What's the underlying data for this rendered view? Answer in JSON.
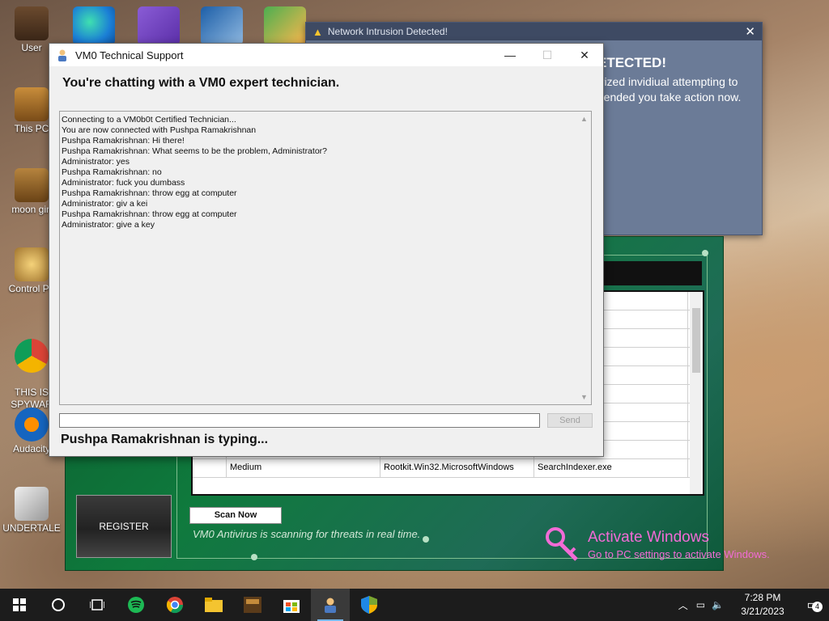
{
  "desktop": {
    "icons": [
      {
        "label": "User"
      },
      {
        "label": "This PC"
      },
      {
        "label": "moon girl"
      },
      {
        "label": "Control Pa"
      },
      {
        "label": "THIS IS\nSPYWAR"
      },
      {
        "label": "Audacity"
      },
      {
        "label": "UNDERTALE"
      }
    ]
  },
  "intrusion_popup": {
    "title": "Network Intrusion Detected!",
    "headline": "ETECTED!",
    "message": "orized invidiual attempting to mended you take action now."
  },
  "antivirus": {
    "rows": [
      {
        "c0": "",
        "c1": "",
        "c2": "",
        "c3": ""
      },
      {
        "c0": "",
        "c1": "",
        "c2": "",
        "c3": ""
      },
      {
        "c0": "",
        "c1": "",
        "c2": "",
        "c3": ""
      },
      {
        "c0": "",
        "c1": "",
        "c2": "",
        "c3": "e"
      },
      {
        "c0": "",
        "c1": "",
        "c2": "",
        "c3": ""
      },
      {
        "c0": "",
        "c1": "",
        "c2": "",
        "c3": ""
      },
      {
        "c0": "",
        "c1": "",
        "c2": "",
        "c3": ""
      },
      {
        "c0": "",
        "c1": "",
        "c2": "",
        "c3": ""
      },
      {
        "c0": "",
        "c1": "High",
        "c2": "Downloader.Win32.PornoDownloader",
        "c3": "svchost.exe"
      },
      {
        "c0": "",
        "c1": "Medium",
        "c2": "Rootkit.Win32.MicrosoftWindows",
        "c3": "SearchIndexer.exe"
      }
    ],
    "register_label": "REGISTER",
    "scan_label": "Scan Now",
    "scan_status": "VM0 Antivirus is scanning for threats in real time."
  },
  "activate": {
    "line1": "Activate Windows",
    "line2": "Go to PC settings to activate Windows."
  },
  "chat_window": {
    "title": "VM0 Technical Support",
    "minimize": "—",
    "maximize": "☐",
    "close": "✕",
    "heading": "You're chatting with a VM0 expert technician.",
    "log": [
      "Connecting to a VM0b0t Certified Technician...",
      "You are now connected with Pushpa Ramakrishnan",
      "Pushpa Ramakrishnan: Hi there!",
      "Pushpa Ramakrishnan: What seems to be the problem, Administrator?",
      "Administrator: yes",
      "Pushpa Ramakrishnan: no",
      "Administrator: fuck you dumbass",
      "Pushpa Ramakrishnan: throw egg at computer",
      "Administrator: giv a kei",
      "Pushpa Ramakrishnan: throw egg at computer",
      "Administrator: give a key"
    ],
    "input_value": "",
    "send_label": "Send",
    "typing_status": "Pushpa Ramakrishnan is typing..."
  },
  "taskbar": {
    "time": "7:28 PM",
    "date": "3/21/2023",
    "notifications": "4"
  }
}
